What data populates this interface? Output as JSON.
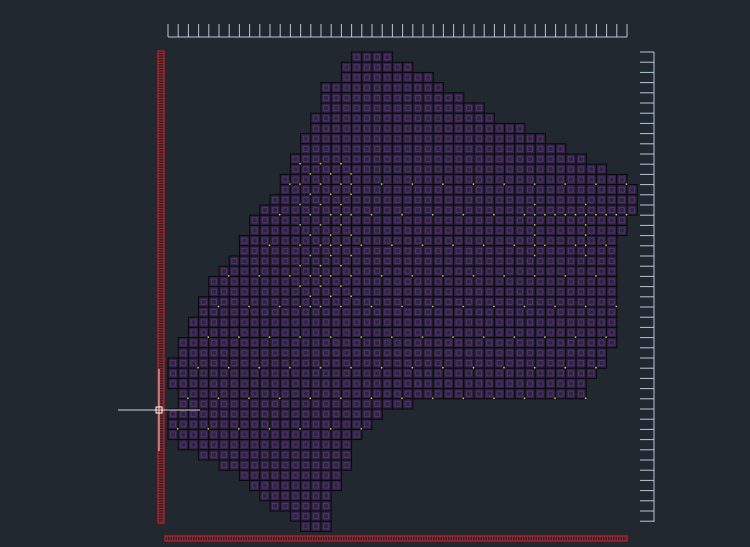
{
  "colors": {
    "background": "#212830",
    "cell_fill": "#2c2540",
    "cell_outer": "#070709",
    "cell_inner": "#5a2d72",
    "marker": "#b8c834",
    "axis_blue": "#b4c8dc",
    "axis_red": "#c61e26",
    "crosshair": "#d8d8d8"
  },
  "icons": {
    "cursor": "crosshair-cursor-icon"
  }
}
